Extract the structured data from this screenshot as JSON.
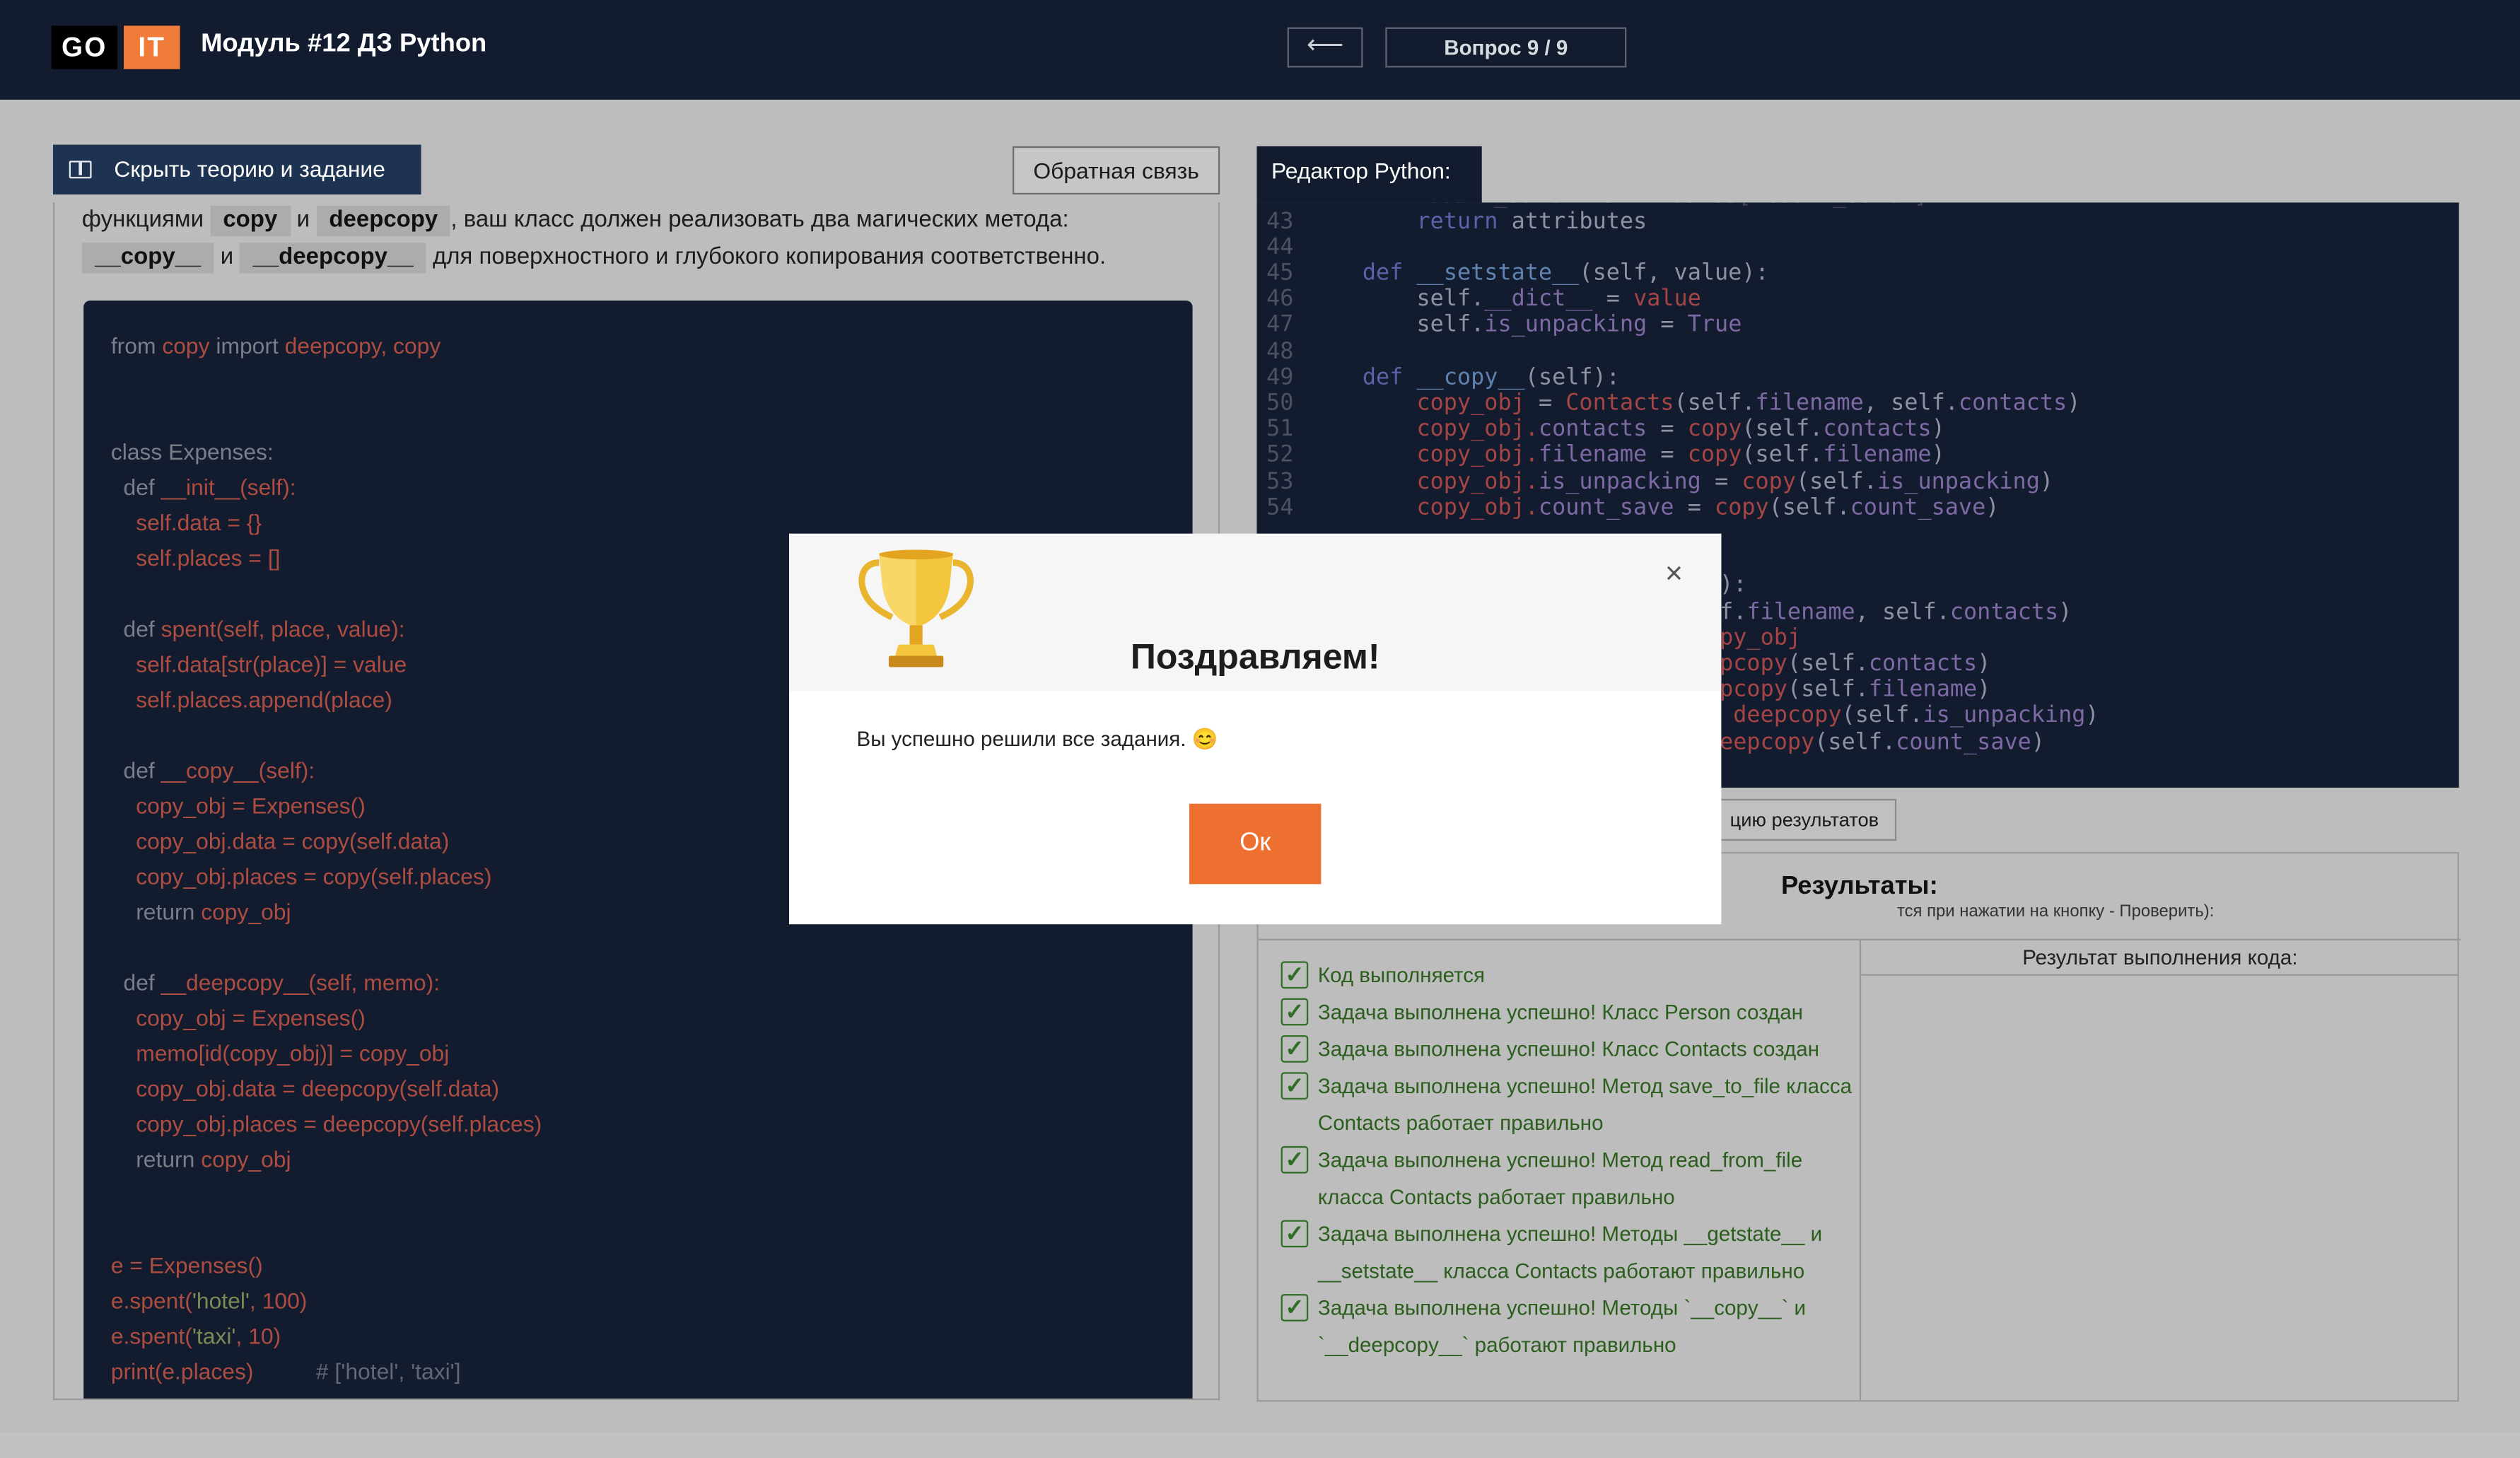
{
  "header": {
    "logo_go": "GO",
    "logo_it": "IT",
    "title": "Модуль #12 ДЗ Python",
    "back_arrow": "⟵",
    "question_counter": "Вопрос 9 / 9"
  },
  "left": {
    "toggle_label": "Скрыть теорию и задание",
    "feedback_label": "Обратная связь",
    "intro": {
      "t1": "функциями ",
      "c1": "copy",
      "t2": " и ",
      "c2": "deepcopy",
      "t3": ", ваш класс должен реализовать два магических метода: ",
      "c3": "__copy__",
      "t4": " и ",
      "c4": "__deepcopy__",
      "t5": " для поверхностного и глубокого копирования соответственно."
    },
    "code": {
      "l1a": "from ",
      "l1b": "copy",
      "l1c": " import ",
      "l1d": "deepcopy, copy",
      "l2": "class Expenses:",
      "l3a": "  def ",
      "l3b": "__init__(self):",
      "l4": "    self.data = {}",
      "l5": "    self.places = []",
      "l6a": "  def ",
      "l6b": "spent(self, place, value):",
      "l7": "    self.data[str(place)] = value",
      "l8": "    self.places.append(place)",
      "l9a": "  def ",
      "l9b": "__copy__(self):",
      "l10": "    copy_obj = Expenses()",
      "l11": "    copy_obj.data = copy(self.data)",
      "l12": "    copy_obj.places = copy(self.places)",
      "l13a": "    return ",
      "l13b": "copy_obj",
      "l14a": "  def ",
      "l14b": "__deepcopy__(self, memo):",
      "l15": "    copy_obj = Expenses()",
      "l16": "    memo[id(copy_obj)] = copy_obj",
      "l17": "    copy_obj.data = deepcopy(self.data)",
      "l18": "    copy_obj.places = deepcopy(self.places)",
      "l19a": "    return ",
      "l19b": "copy_obj",
      "l20": "e = Expenses()",
      "l21a": "e.spent(",
      "l21b": "'hotel'",
      "l21c": ", 100)",
      "l22a": "e.spent(",
      "l22b": "'taxi'",
      "l22c": ", 10)",
      "l23a": "print(e.places)",
      "l23b": "          # ['hotel', 'taxi']"
    }
  },
  "editor": {
    "tab_label": "Редактор Python:",
    "line_numbers": [
      "43",
      "44",
      "45",
      "46",
      "47",
      "48",
      "49",
      "50",
      "51",
      "52",
      "53",
      "54"
    ],
    "lines": {
      "e43a": "        return ",
      "e43b": "attributes",
      "e45a": "    def ",
      "e45b": "__setstate__",
      "e45c": "(self, value):",
      "e46a": "        self.",
      "e46b": "__dict__",
      "e46c": " = ",
      "e46d": "value",
      "e47a": "        self.",
      "e47b": "is_unpacking",
      "e47c": " = ",
      "e47d": "True",
      "e49a": "    def ",
      "e49b": "__copy__",
      "e49c": "(self):",
      "e50a": "        copy_obj",
      "e50b": " = ",
      "e50c": "Contacts",
      "e50d": "(self.",
      "e50e": "filename",
      "e50f": ", self.",
      "e50g": "contacts",
      "e50h": ")",
      "e51a": "        copy_obj.",
      "e51b": "contacts",
      "e51c": " = ",
      "e51d": "copy",
      "e51e": "(self.",
      "e51f": "contacts",
      "e51g": ")",
      "e52a": "        copy_obj.",
      "e52b": "filename",
      "e52c": " = ",
      "e52d": "copy",
      "e52e": "(self.",
      "e52f": "filename",
      "e52g": ")",
      "e53a": "        copy_obj.",
      "e53b": "is_unpacking",
      "e53c": " = ",
      "e53d": "copy",
      "e53e": "(self.",
      "e53f": "is_unpacking",
      "e53g": ")",
      "e54a": "        copy_obj.",
      "e54b": "count_save",
      "e54c": " = ",
      "e54d": "copy",
      "e54e": "(self.",
      "e54f": "count_save",
      "e54g": ")",
      "r1": "):",
      "r2a": "f.",
      "r2b": "filename",
      "r2c": ", self.",
      "r2d": "contacts",
      "r2e": ")",
      "r3": "py_obj",
      "r4a": "pcopy",
      "r4b": "(self.",
      "r4c": "contacts",
      "r4d": ")",
      "r5a": "pcopy",
      "r5b": "(self.",
      "r5c": "filename",
      "r5d": ")",
      "r6a": " deepcopy",
      "r6b": "(self.",
      "r6c": "is_unpacking",
      "r6d": ")",
      "r7a": "eepcopy",
      "r7b": "(self.",
      "r7c": "count_save",
      "r7d": ")"
    }
  },
  "generate_button": "цию результатов",
  "results": {
    "title": "Результаты:",
    "subtitle": "тся при нажатии на кнопку - Проверить):",
    "output_header": "Результат выполнения кода:",
    "items": [
      "Код выполняется",
      "Задача выполнена успешно! Класс Person создан",
      "Задача выполнена успешно! Класс Contacts создан",
      "Задача выполнена успешно! Метод save_to_file класса Contacts работает правильно",
      "Задача выполнена успешно! Метод read_from_file класса Contacts работает правильно",
      "Задача выполнена успешно! Методы __getstate__ и __setstate__ класса Contacts работают правильно",
      "Задача выполнена успешно! Методы `__copy__` и `__deepcopy__` работают правильно"
    ]
  },
  "modal": {
    "title": "Поздравляем!",
    "text": "Вы успешно решили все задания. 😊",
    "ok": "Ок",
    "close": "×"
  },
  "colors": {
    "header_bg": "#121c2e",
    "accent_orange": "#ed7030",
    "success_green": "#2b5e1d",
    "trophy_gold": "#f2c53d"
  }
}
